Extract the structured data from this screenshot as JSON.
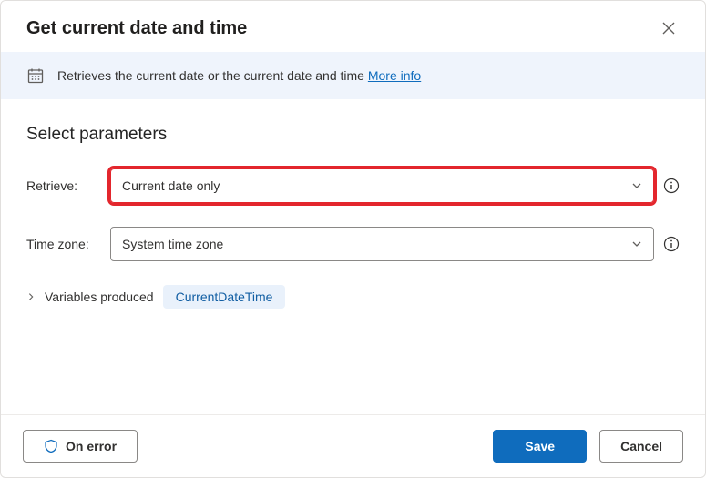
{
  "header": {
    "title": "Get current date and time"
  },
  "info": {
    "description": "Retrieves the current date or the current date and time ",
    "link_label": "More info"
  },
  "section_title": "Select parameters",
  "params": {
    "retrieve": {
      "label": "Retrieve:",
      "value": "Current date only"
    },
    "timezone": {
      "label": "Time zone:",
      "value": "System time zone"
    }
  },
  "vars": {
    "label": "Variables produced",
    "variable": "CurrentDateTime"
  },
  "footer": {
    "on_error": "On error",
    "save": "Save",
    "cancel": "Cancel"
  }
}
